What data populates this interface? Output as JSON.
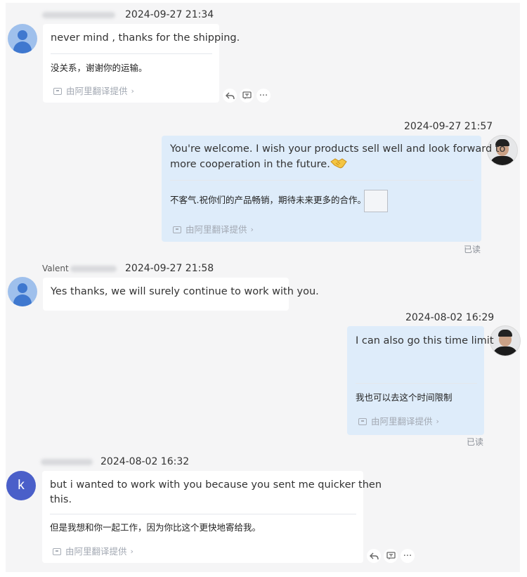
{
  "messages": [
    {
      "timestamp": "2024-09-27 21:34",
      "text": "never mind , thanks for the shipping.",
      "translation": "没关系，谢谢你的运输。",
      "credit": "由阿里翻译提供"
    },
    {
      "timestamp": "2024-09-27 21:57",
      "text_line1": "You're welcome. I wish your products sell well and look forward to",
      "text_line2": "more cooperation in the future.",
      "translation": "不客气.祝你们的产品畅销，期待未来更多的合作。",
      "credit": "由阿里翻译提供",
      "status": "已读"
    },
    {
      "timestamp": "2024-09-27 21:58",
      "text": "Yes thanks, we will surely continue to work with you."
    },
    {
      "timestamp": "2024-08-02 16:29",
      "text": "I can also go this time limit",
      "translation": "我也可以去这个时间限制",
      "credit": "由阿里翻译提供",
      "status": "已读"
    },
    {
      "timestamp": "2024-08-02 16:32",
      "avatar_letter": "k",
      "text_line1": "but i wanted to work with you because you sent me quicker then",
      "text_line2": "this.",
      "translation": "但是我想和你一起工作，因为你比这个更快地寄给我。",
      "credit": "由阿里翻译提供"
    }
  ],
  "partial_names": {
    "m3": "Valent"
  },
  "colors": {
    "incoming_bubble": "#ffffff",
    "outgoing_bubble": "#deecfa",
    "panel_background": "#f5f5f6",
    "credit_text": "#a3a9b3",
    "letter_avatar": "#4a5fc9"
  },
  "icons": {
    "reply": "reply-icon",
    "translate": "translate-icon",
    "more": "more-icon",
    "handshake": "handshake-emoji"
  }
}
